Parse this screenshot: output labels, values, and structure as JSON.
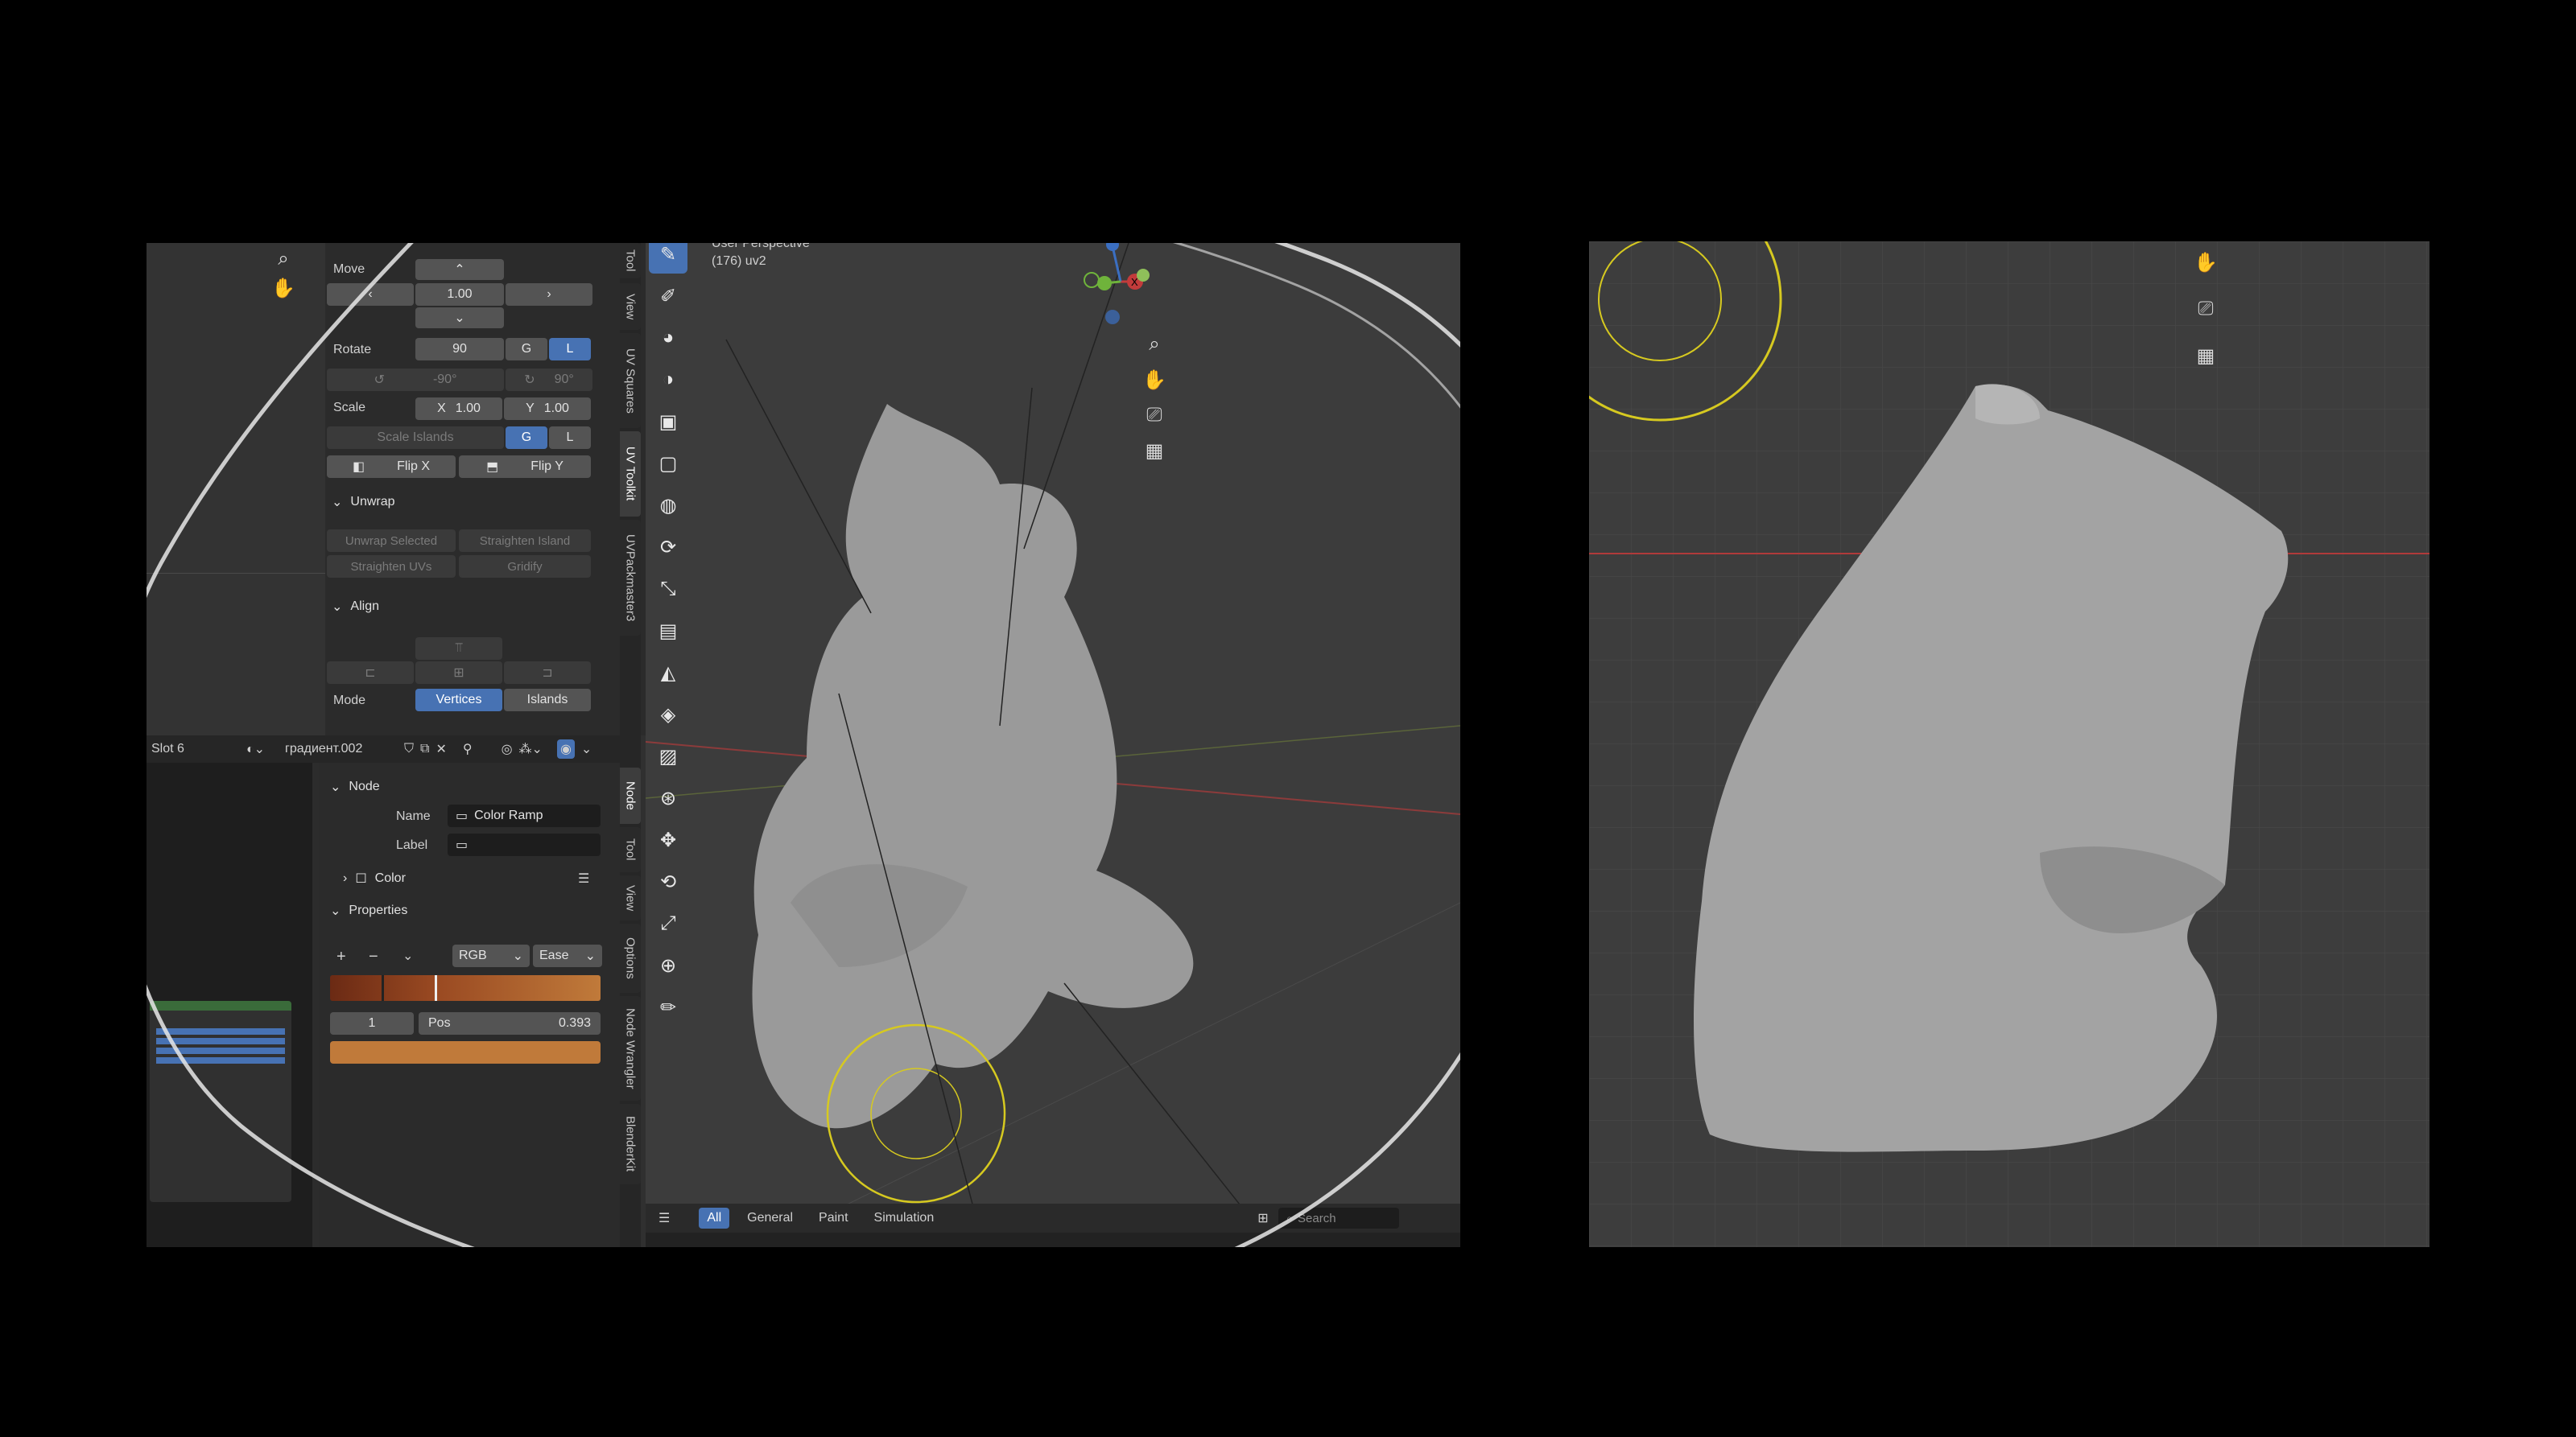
{
  "tool_panel": {
    "move_label": "Move",
    "move_value": "1.00",
    "rotate_label": "Rotate",
    "rotate_value": "90",
    "g_label": "G",
    "l_label": "L",
    "rot_minus": "-90°",
    "rot_plus": "90°",
    "scale_label": "Scale",
    "scale_x_label": "X",
    "scale_x_value": "1.00",
    "scale_y_label": "Y",
    "scale_y_value": "1.00",
    "scale_islands": "Scale Islands",
    "flip_x": "Flip X",
    "flip_y": "Flip Y",
    "unwrap_header": "Unwrap",
    "unwrap_selected": "Unwrap Selected",
    "straighten_island": "Straighten Island",
    "straighten_uvs": "Straighten UVs",
    "gridify": "Gridify",
    "align_header": "Align",
    "mode_label": "Mode",
    "mode_vertices": "Vertices",
    "mode_islands": "Islands"
  },
  "side_tabs_top": [
    "Tool",
    "View",
    "UV Squares",
    "UV Toolkit",
    "UVPackmaster3"
  ],
  "side_tabs_bottom": [
    "Node",
    "Tool",
    "View",
    "Options",
    "Node Wrangler",
    "BlenderKit"
  ],
  "shader_header": {
    "slot": "Slot 6",
    "material": "градиент.002"
  },
  "node_panel": {
    "node_header": "Node",
    "name_label": "Name",
    "name_value": "Color Ramp",
    "label_label": "Label",
    "color_label": "Color",
    "properties_header": "Properties",
    "plus": "+",
    "minus": "−",
    "mode_select": "RGB",
    "interp_select": "Ease",
    "index_value": "1",
    "pos_label": "Pos",
    "pos_value": "0.393"
  },
  "viewport": {
    "view_name": "User Perspective",
    "object_info": "(176) uv2"
  },
  "asset_bar": {
    "tabs": [
      "All",
      "General",
      "Paint",
      "Simulation"
    ],
    "search_placeholder": "Search"
  },
  "colors": {
    "accent_blue": "#4772b3",
    "ramp_start": "#6b2a14",
    "ramp_end": "#c07a3a",
    "swatch": "#c07a3a",
    "brush_circle": "#d6c920",
    "x_axis": "#c23b3b"
  }
}
